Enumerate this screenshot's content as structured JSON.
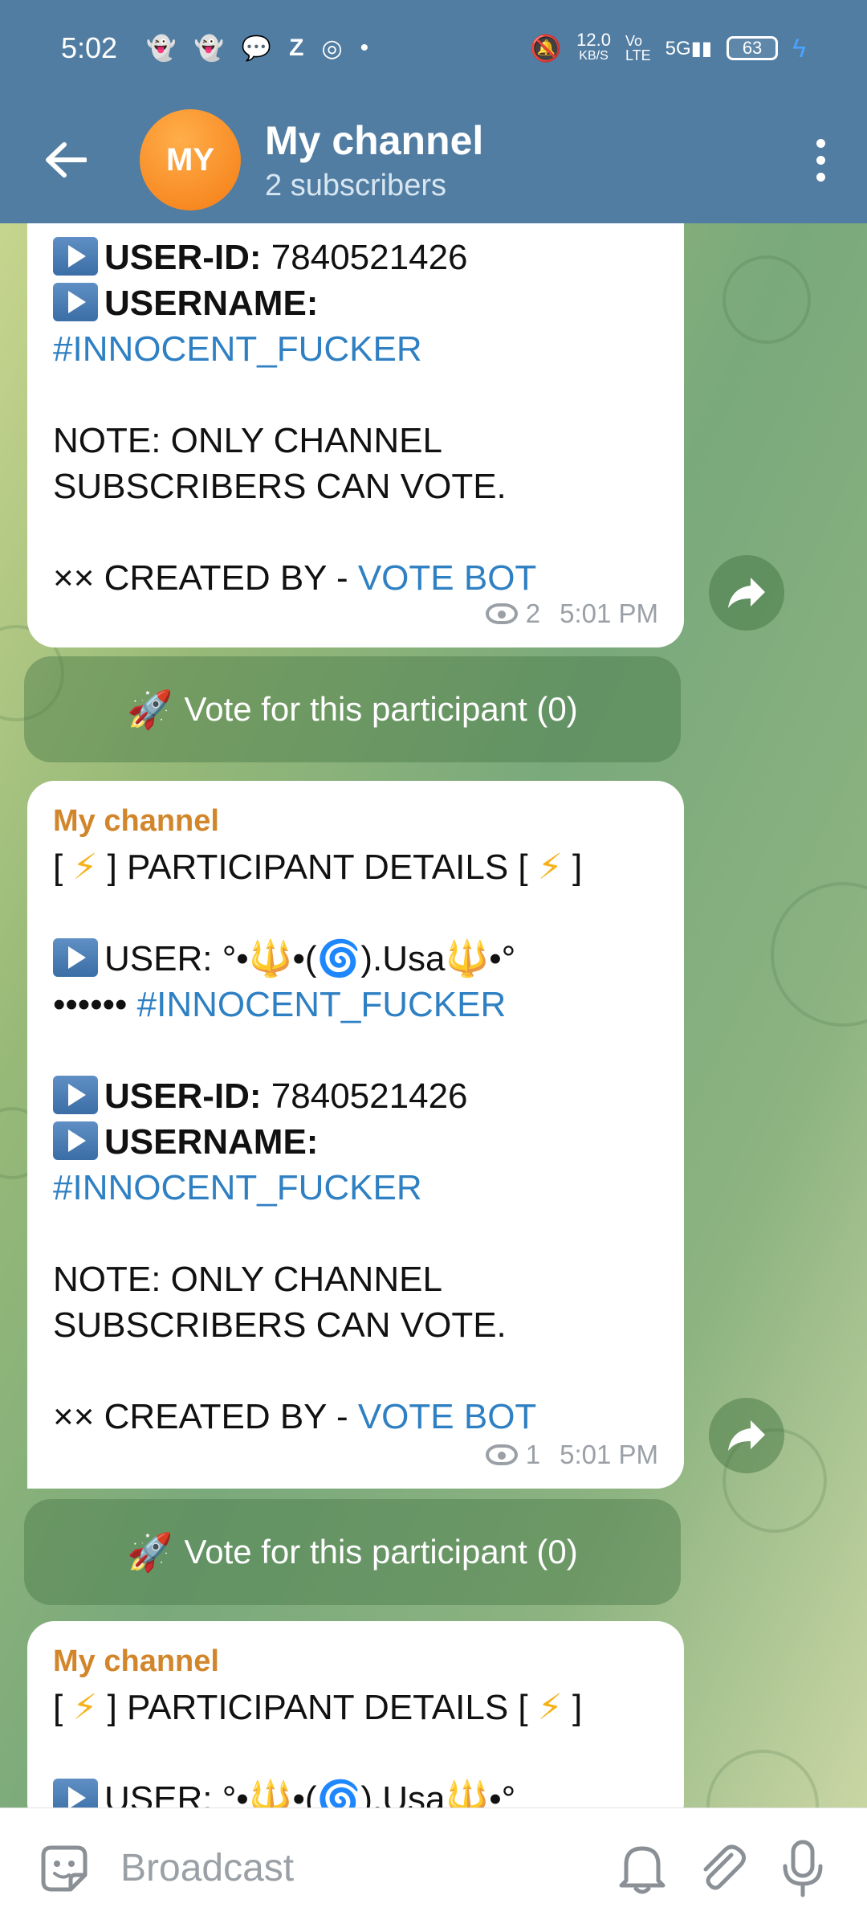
{
  "status": {
    "time": "5:02",
    "left_icons": [
      "ghost-icon",
      "ghost-icon",
      "chat-icon",
      "z-icon",
      "instagram-icon",
      "dot-icon"
    ],
    "net_speed": "12.0",
    "net_unit": "KB/S",
    "volte": "Vo",
    "volte2": "LTE",
    "network": "5G",
    "battery": "63"
  },
  "header": {
    "avatar_initials": "MY",
    "title": "My channel",
    "subtitle": "2 subscribers"
  },
  "messages": [
    {
      "lines": {
        "userid_label": "USER-ID:",
        "userid_value": "7840521426",
        "username_label": "USERNAME:",
        "username_tag": "#INNOCENT_FUCKER",
        "note1": "NOTE: ONLY CHANNEL",
        "note2": "SUBSCRIBERS CAN VOTE.",
        "created_prefix": "×× CREATED BY - ",
        "created_link": "VOTE BOT"
      },
      "views": "2",
      "time": "5:01 PM",
      "vote_label": "Vote for this participant (0)"
    },
    {
      "sender": "My channel",
      "lines": {
        "header_left": "[ ",
        "header_text": " ] PARTICIPANT DETAILS [ ",
        "header_right": " ]",
        "user_label": "USER: °•",
        "user_mid": "•(",
        "user_mid2": ").Usa",
        "user_end": "•°",
        "dots": "•••••• ",
        "user_tag": "#INNOCENT_FUCKER",
        "userid_label": "USER-ID:",
        "userid_value": "7840521426",
        "username_label": "USERNAME:",
        "username_tag": "#INNOCENT_FUCKER",
        "note1": "NOTE: ONLY CHANNEL",
        "note2": "SUBSCRIBERS CAN VOTE.",
        "created_prefix": "×× CREATED BY - ",
        "created_link": "VOTE BOT"
      },
      "views": "1",
      "time": "5:01 PM",
      "vote_label": "Vote for this participant (0)"
    },
    {
      "sender": "My channel",
      "lines": {
        "header_left": "[ ",
        "header_text": " ] PARTICIPANT DETAILS [ ",
        "header_right": " ]",
        "user_label": "USER: °•",
        "user_mid": "•(",
        "user_mid2": ").Usa",
        "user_end": "•°"
      }
    }
  ],
  "input": {
    "placeholder": "Broadcast"
  },
  "colors": {
    "header": "#517da2",
    "link": "#2f80c3",
    "sender": "#d2862c"
  }
}
